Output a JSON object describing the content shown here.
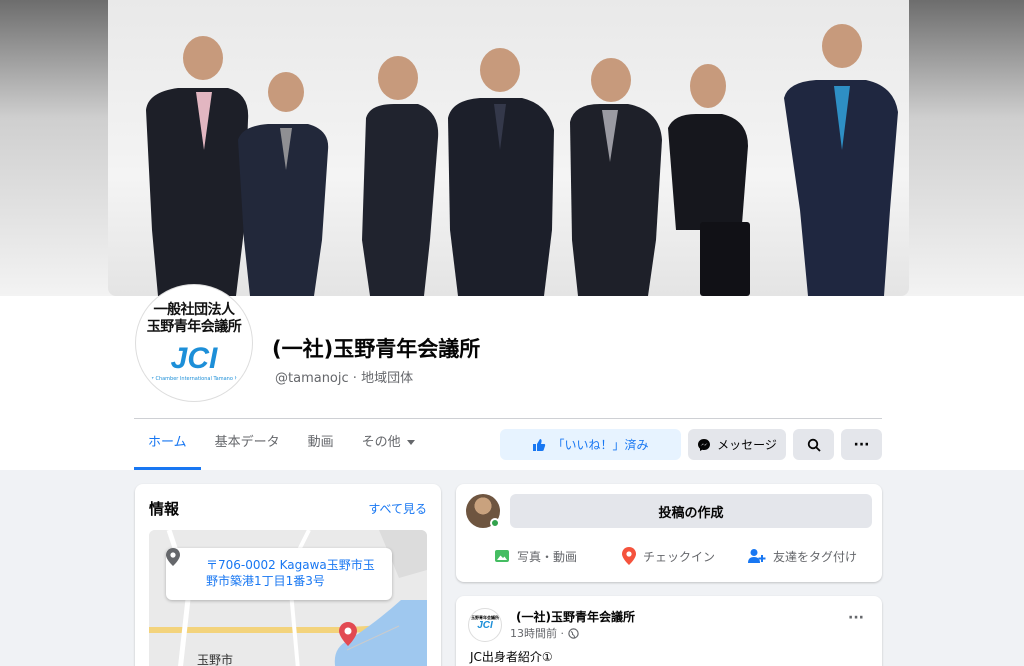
{
  "page": {
    "name": "(一社)玉野青年会議所",
    "handle": "@tamanojc",
    "category": "地域団体",
    "logo": {
      "line1": "一般社団法人",
      "line2": "玉野青年会議所",
      "mark": "JCI",
      "tagline": "Junior Chamber International Tamano Japan"
    }
  },
  "tabs": [
    {
      "label": "ホーム",
      "active": true
    },
    {
      "label": "基本データ",
      "active": false
    },
    {
      "label": "動画",
      "active": false
    },
    {
      "label": "その他",
      "active": false,
      "icon": "caret-down-icon"
    }
  ],
  "actions": {
    "like_label": "「いいね！」済み",
    "message_label": "メッセージ",
    "search_icon": "search-icon",
    "more_label": "···"
  },
  "info": {
    "title": "情報",
    "see_all": "すべて見る",
    "address": "〒706-0002 Kagawa玉野市玉野市築港1丁目1番3号",
    "map_label": "玉野市"
  },
  "composer": {
    "button_label": "投稿の作成",
    "actions": [
      {
        "label": "写真・動画",
        "icon": "photo-icon",
        "color": "#45bd62"
      },
      {
        "label": "チェックイン",
        "icon": "location-pin-icon",
        "color": "#f5533d"
      },
      {
        "label": "友達をタグ付け",
        "icon": "tag-friends-icon",
        "color": "#1877f2"
      }
    ]
  },
  "post": {
    "author": "(一社)玉野青年会議所",
    "time": "13時間前 ·",
    "text": "JC出身者紹介①",
    "more_label": "···"
  },
  "colors": {
    "accent": "#1877f2",
    "like_bg": "#e7f3ff",
    "button_bg": "#e4e6eb",
    "page_bg": "#f0f2f5"
  }
}
